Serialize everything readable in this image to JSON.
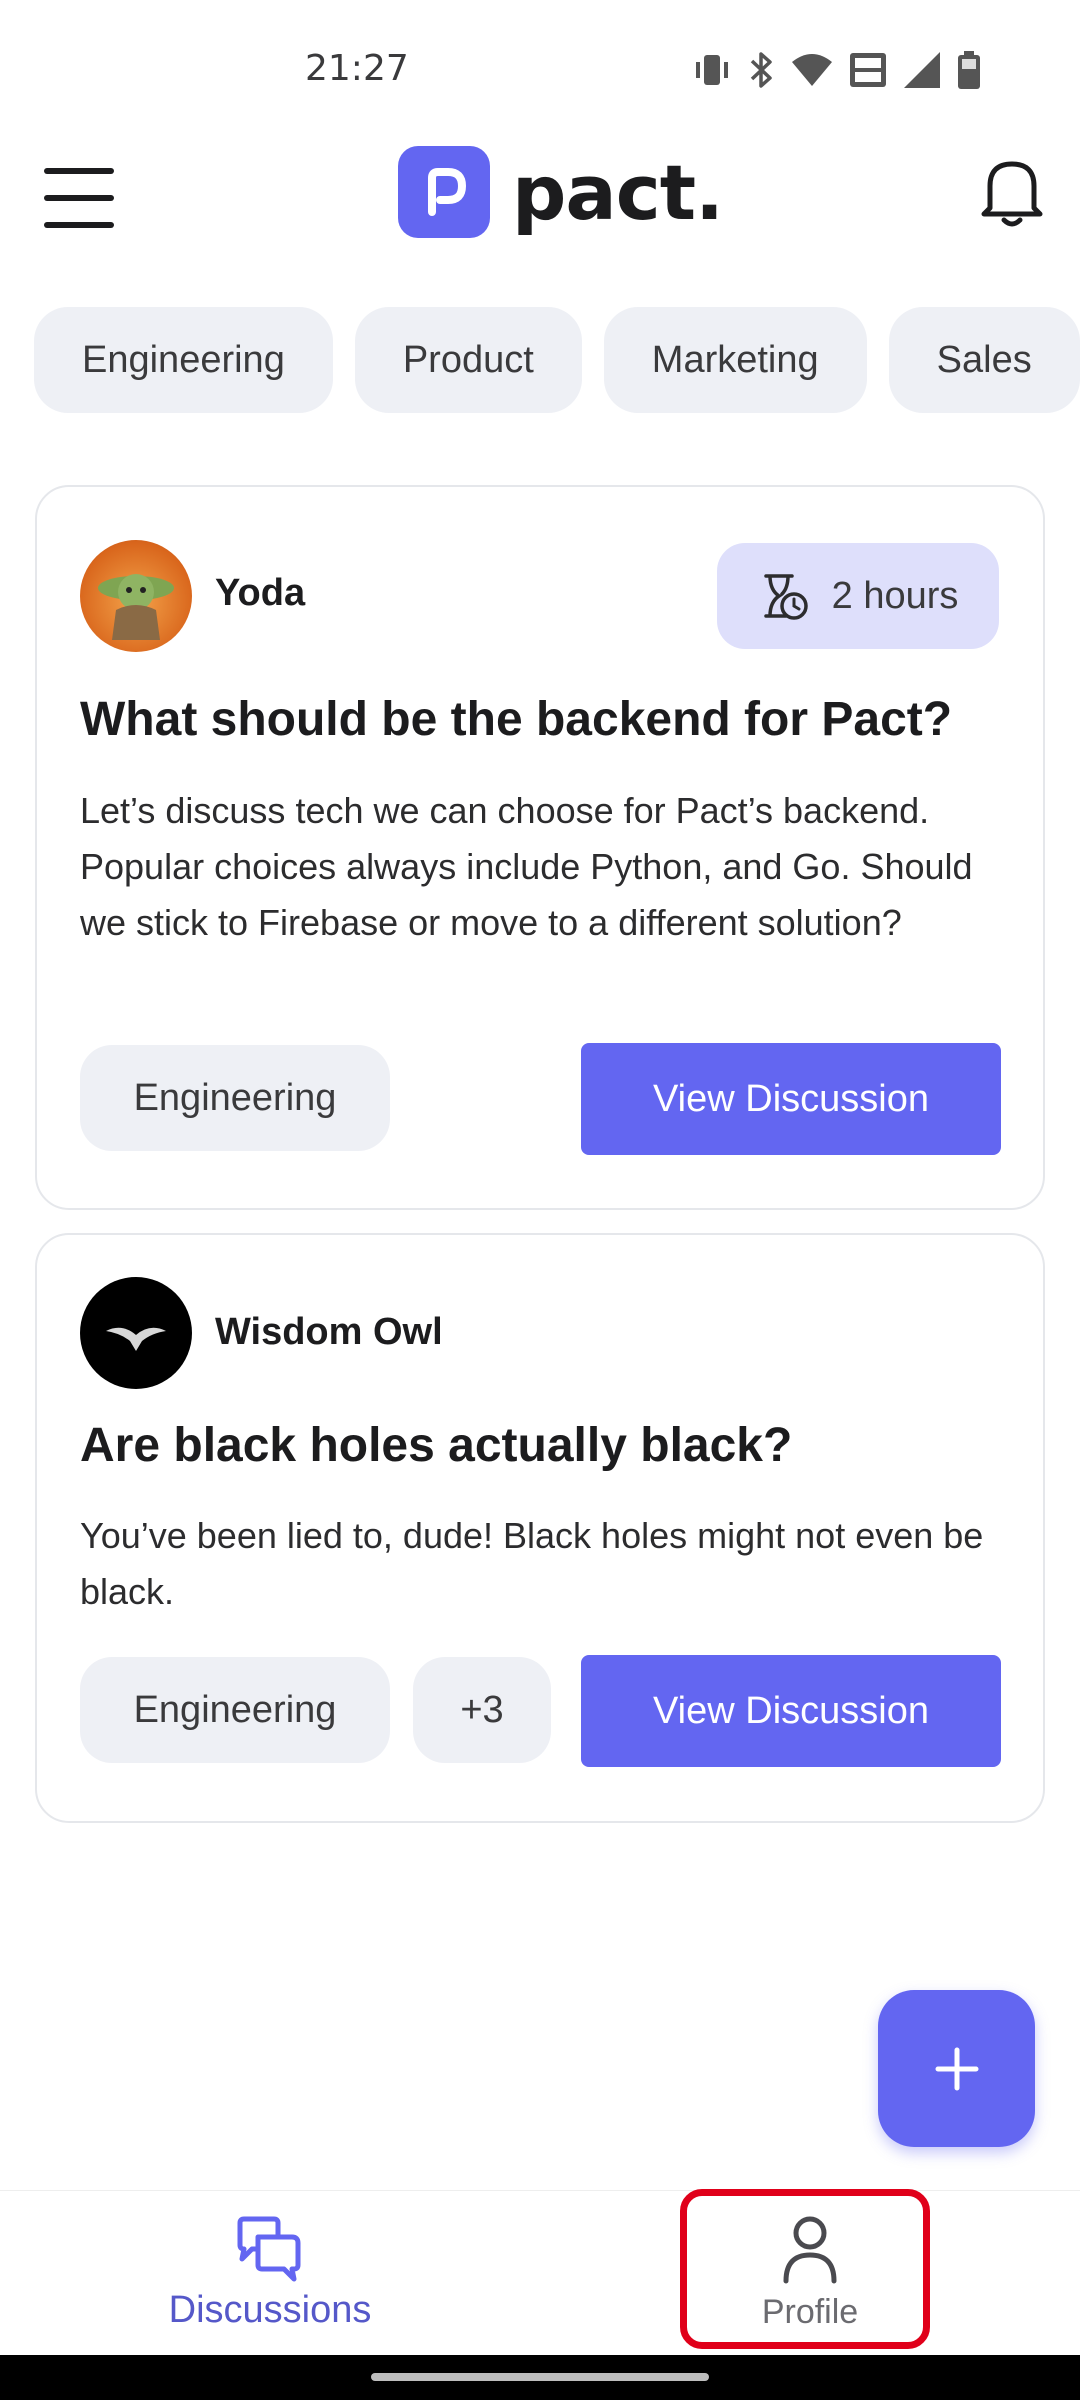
{
  "status_bar": {
    "time": "21:27",
    "icons": [
      "vibrate-icon",
      "bluetooth-icon",
      "wifi-icon",
      "volte-icon",
      "signal-icon",
      "battery-icon"
    ]
  },
  "header": {
    "logo_letter": "p",
    "logo_text": "pact."
  },
  "categories": [
    "Engineering",
    "Product",
    "Marketing",
    "Sales"
  ],
  "posts": [
    {
      "author": "Yoda",
      "time": "2 hours",
      "title": "What should be the backend for Pact?",
      "body": "Let’s discuss tech we can choose for Pact’s backend. Popular choices always include Python, and Go. Should we stick to Firebase or move to a different solution?",
      "tags": [
        "Engineering"
      ],
      "action": "View Discussion"
    },
    {
      "author": "Wisdom Owl",
      "title": "Are black holes actually black?",
      "body": "You’ve been lied to, dude! Black holes might not even be black.",
      "tags": [
        "Engineering",
        "+3"
      ],
      "action": "View Discussion"
    }
  ],
  "bottom_nav": {
    "items": [
      {
        "label": "Discussions",
        "icon": "chat-bubbles-icon"
      },
      {
        "label": "Profile",
        "icon": "person-icon"
      }
    ]
  },
  "colors": {
    "accent": "#6366f1",
    "chip_bg": "#eef0f5",
    "badge_bg": "#dedffb",
    "highlight": "#e0001a"
  }
}
